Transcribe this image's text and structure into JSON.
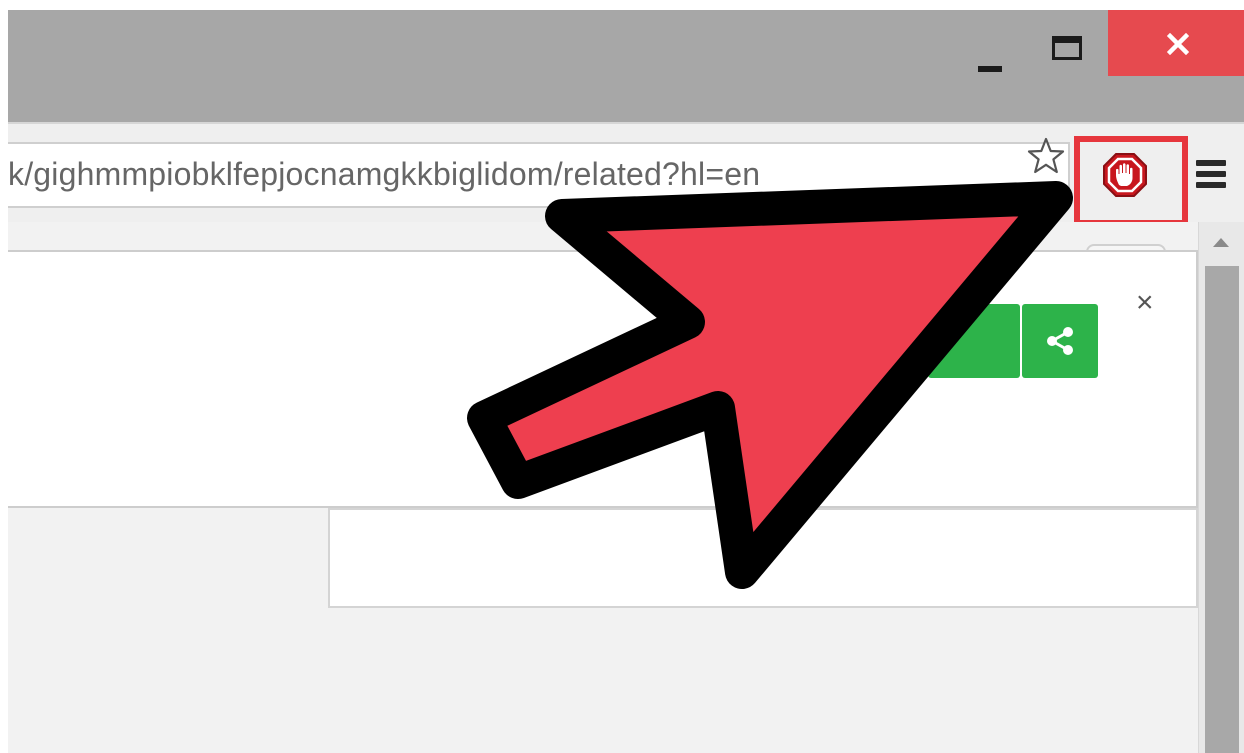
{
  "window": {
    "controls": {
      "minimize_icon": "minimize-icon",
      "maximize_icon": "maximize-icon",
      "close_icon": "close-icon",
      "close_color": "#e64a4f"
    }
  },
  "omnibox": {
    "url": "k/gighmmpiobklfepjocnamgkkbiglidom/related?hl=en"
  },
  "toolbar": {
    "bookmark_icon": "star-icon",
    "extension_icon": "adblock-stop-hand-icon",
    "extension_highlight_color": "#e6363d",
    "menu_icon": "hamburger-menu-icon"
  },
  "dialog": {
    "close_icon": "close-icon",
    "share_icon": "share-icon",
    "button_color": "#2db34a"
  },
  "annotation": {
    "arrow_icon": "pointer-arrow-icon",
    "arrow_color": "#ee3f4f"
  }
}
